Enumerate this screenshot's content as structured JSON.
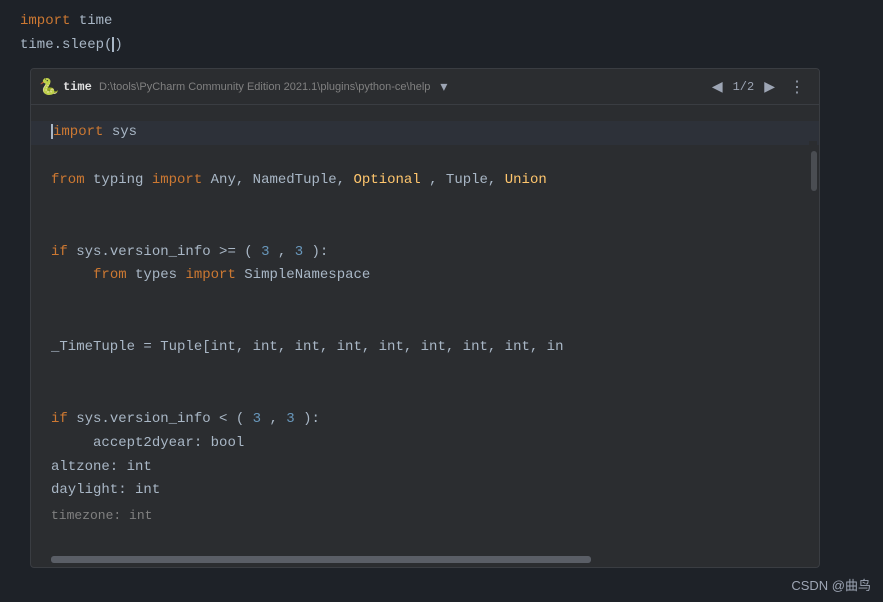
{
  "editor": {
    "top_lines": [
      {
        "content": "import time",
        "parts": [
          {
            "text": "import",
            "class": "kw-orange"
          },
          {
            "text": " time",
            "class": "text-white"
          }
        ]
      },
      {
        "content": "time.sleep()",
        "parts": [
          {
            "text": "time.sleep()",
            "class": "text-white"
          }
        ]
      }
    ]
  },
  "popup": {
    "header": {
      "icon": "🐍",
      "module": "time",
      "path": "D:\\tools\\PyCharm Community Edition 2021.1\\plugins\\python-ce\\help",
      "counter": "1/2",
      "dropdown_label": "dropdown",
      "prev_label": "◀",
      "next_label": "▶",
      "more_label": "⋮"
    },
    "code_lines": [
      {
        "id": 1,
        "text": "import sys",
        "cursor": true
      },
      {
        "id": 2,
        "text": ""
      },
      {
        "id": 3,
        "text": "from typing import Any, NamedTuple, Optional, Tuple, Union"
      },
      {
        "id": 4,
        "text": ""
      },
      {
        "id": 5,
        "text": ""
      },
      {
        "id": 6,
        "text": "if sys.version_info >= (3, 3):"
      },
      {
        "id": 7,
        "text": "    from types import SimpleNamespace"
      },
      {
        "id": 8,
        "text": ""
      },
      {
        "id": 9,
        "text": ""
      },
      {
        "id": 10,
        "text": "_TimeTuple = Tuple[int, int, int, int, int, int, int, int, in"
      },
      {
        "id": 11,
        "text": ""
      },
      {
        "id": 12,
        "text": ""
      },
      {
        "id": 13,
        "text": "if sys.version_info < (3, 3):"
      },
      {
        "id": 14,
        "text": "    accept2dyear: bool"
      },
      {
        "id": 15,
        "text": "altzone: int"
      },
      {
        "id": 16,
        "text": "daylight: int"
      },
      {
        "id": 17,
        "text": "timezone: int"
      }
    ]
  },
  "watermark": "CSDN @曲鸟"
}
